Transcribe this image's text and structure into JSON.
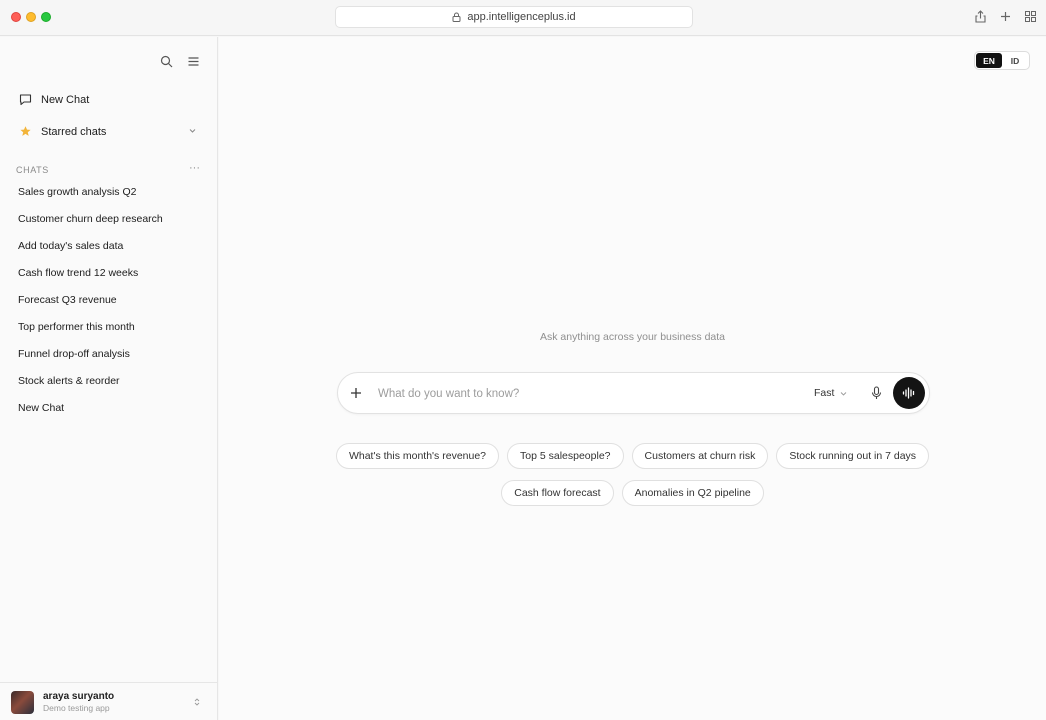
{
  "browser": {
    "url": "app.intelligenceplus.id"
  },
  "sidebar": {
    "new_chat": "New Chat",
    "starred": "Starred chats",
    "section_title": "CHATS",
    "section_more": "···",
    "chats": [
      "Sales growth analysis Q2",
      "Customer churn deep research",
      "Add today's sales data",
      "Cash flow trend 12 weeks",
      "Forecast Q3 revenue",
      "Top performer this month",
      "Funnel drop-off analysis",
      "Stock alerts & reorder",
      "New Chat"
    ],
    "user": {
      "name": "araya suryanto",
      "subtitle": "Demo testing app"
    }
  },
  "main": {
    "lang": {
      "en": "EN",
      "id": "ID",
      "selected": "EN"
    },
    "hint": "Ask anything across your business data",
    "composer": {
      "placeholder": "What do you want to know?",
      "mode": "Fast"
    },
    "suggestions_row1": [
      "What's this month's revenue?",
      "Top 5 salespeople?",
      "Customers at churn risk",
      "Stock running out in 7 days"
    ],
    "suggestions_row2": [
      "Cash flow forecast",
      "Anomalies in Q2 pipeline"
    ]
  },
  "colors": {
    "accent_star": "#f2b43a",
    "primary_dark": "#141414"
  }
}
